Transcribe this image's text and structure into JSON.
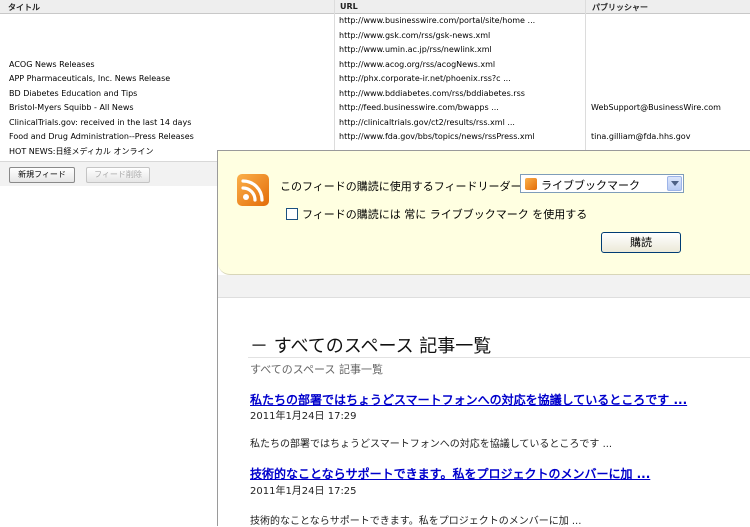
{
  "feedlist": {
    "columns": {
      "title": "タイトル",
      "url": "URL",
      "publisher": "パブリッシャー"
    },
    "rows": [
      {
        "title": "",
        "url": "http://www.businesswire.com/portal/site/home ...",
        "publisher": ""
      },
      {
        "title": "",
        "url": "http://www.gsk.com/rss/gsk-news.xml",
        "publisher": ""
      },
      {
        "title": "",
        "url": "http://www.umin.ac.jp/rss/newlink.xml",
        "publisher": ""
      },
      {
        "title": "ACOG News Releases",
        "url": "http://www.acog.org/rss/acogNews.xml",
        "publisher": ""
      },
      {
        "title": "APP Pharmaceuticals, Inc. News Release",
        "url": "http://phx.corporate-ir.net/phoenix.rss?c ...",
        "publisher": ""
      },
      {
        "title": "BD Diabetes Education and Tips",
        "url": "http://www.bddiabetes.com/rss/bddiabetes.rss",
        "publisher": ""
      },
      {
        "title": "Bristol-Myers Squibb - All News",
        "url": "http://feed.businesswire.com/bwapps ...",
        "publisher": "WebSupport@BusinessWire.com"
      },
      {
        "title": "ClinicalTrials.gov: received in the last 14 days",
        "url": "http://clinicaltrials.gov/ct2/results/rss.xml ...",
        "publisher": ""
      },
      {
        "title": "Food and Drug Administration--Press Releases",
        "url": "http://www.fda.gov/bbs/topics/news/rssPress.xml",
        "publisher": "tina.gilliam@fda.hhs.gov"
      },
      {
        "title": "HOT NEWS:日経メディカル オンライン",
        "url": "",
        "publisher": ""
      }
    ],
    "buttons": {
      "new_feed": "新規フィード",
      "delete_feed": "フィード削除"
    }
  },
  "subscribe": {
    "label": "このフィードの購読に使用するフィードリーダー:",
    "reader_selected": "ライブブックマーク",
    "always_use_label": "フィードの購読には 常に ライブブックマーク を使用する",
    "always_use_checked": false,
    "button": "購読"
  },
  "content": {
    "title": "－ すべてのスペース  記事一覧",
    "breadcrumb": "すべてのスペース  記事一覧",
    "posts": [
      {
        "title": "私たちの部署ではちょうどスマートフォンへの対応を協議しているところです ...",
        "date": "2011年1月24日  17:29",
        "snippet": "私たちの部署ではちょうどスマートフォンへの対応を協議しているところです ..."
      },
      {
        "title": "技術的なことならサポートできます。私をプロジェクトのメンバーに加 ...",
        "date": "2011年1月24日  17:25",
        "snippet": "技術的なことならサポートできます。私をプロジェクトのメンバーに加 ..."
      }
    ]
  },
  "colors": {
    "subscribe_bg": "#ffffe1",
    "link": "#0000cc",
    "rss_orange": "#e36c09"
  },
  "icons": {
    "feed": "rss-icon",
    "dropdown": "chevron-down-icon"
  }
}
